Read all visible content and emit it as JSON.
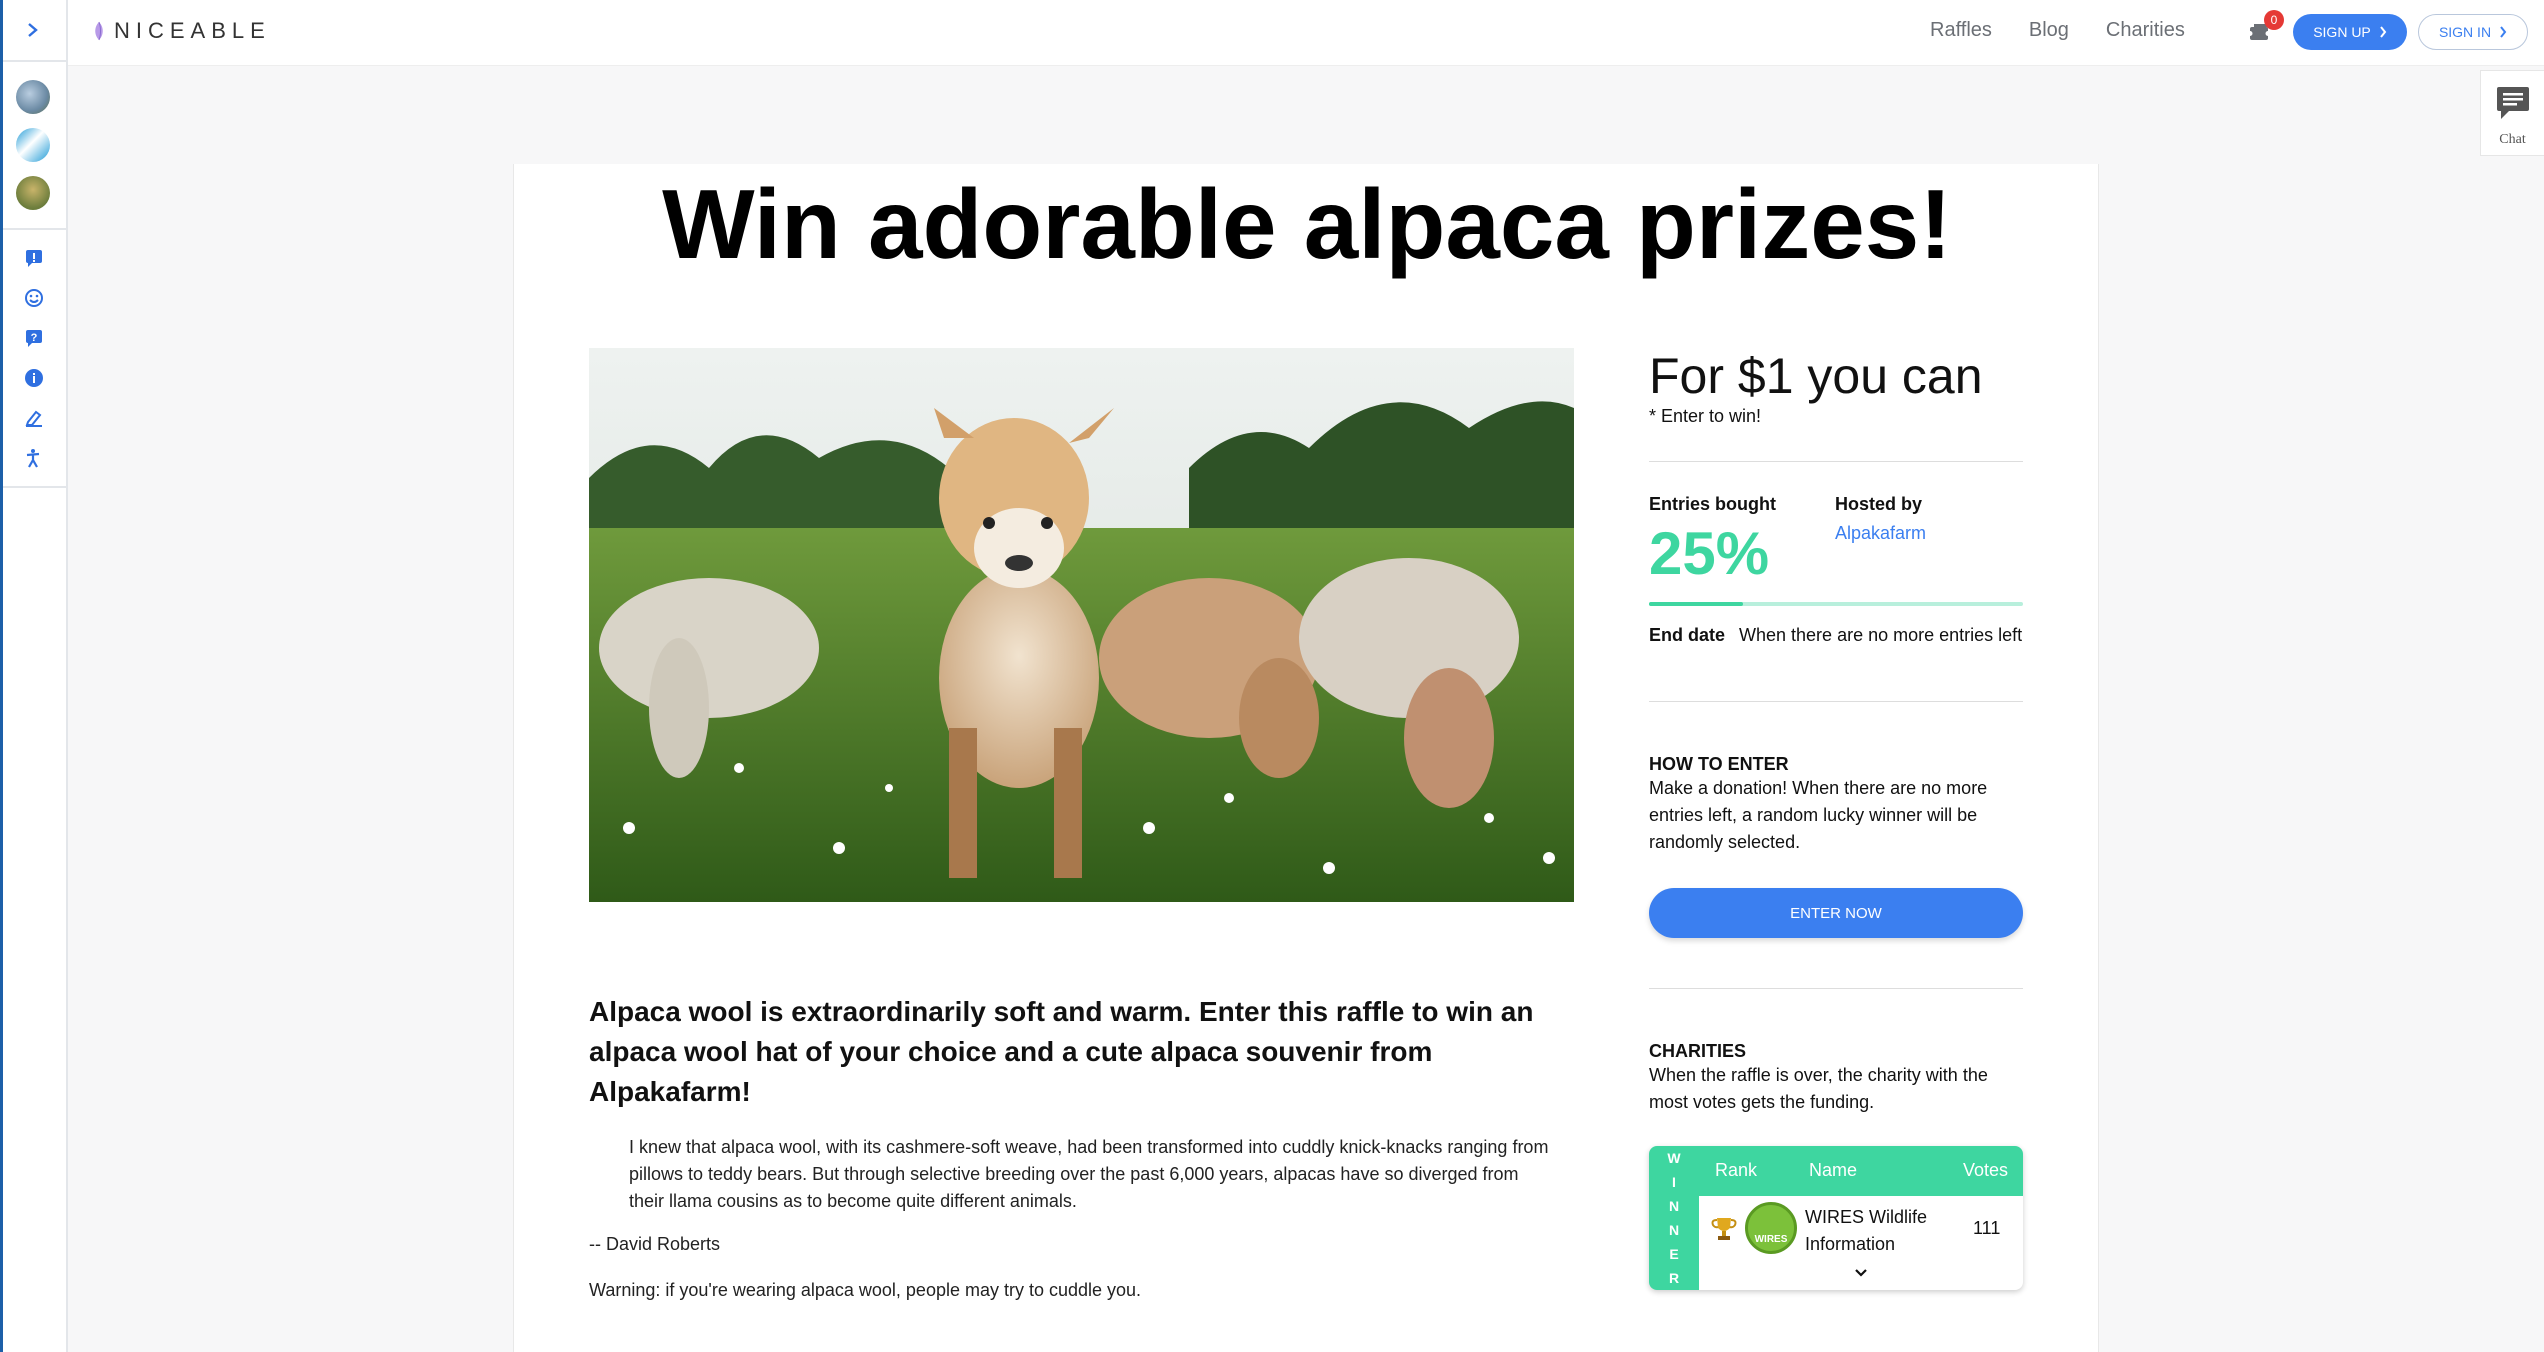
{
  "header": {
    "logo": "NICEABLE",
    "nav": [
      "Raffles",
      "Blog",
      "Charities"
    ],
    "cart_count": "0",
    "signup_label": "SIGN UP",
    "signin_label": "SIGN IN"
  },
  "chat": {
    "label": "Chat"
  },
  "page": {
    "title": "Win adorable alpaca prizes!",
    "lead": "Alpaca wool is extraordinarily soft and warm. Enter this raffle to win an alpaca wool hat of your choice and a cute alpaca souvenir from Alpakafarm!",
    "quote": "I knew that alpaca wool, with its cashmere-soft weave, had been transformed into cuddly knick-knacks ranging from pillows to teddy bears. But through selective breeding over the past 6,000 years, alpacas have so diverged from their llama cousins as to become quite different animals.",
    "author": "-- David Roberts",
    "warning": "Warning: if you're wearing alpaca wool, people may try to cuddle you."
  },
  "side": {
    "for_line": "For $1 you can",
    "enter_line": "* Enter to win!",
    "entries_label": "Entries bought",
    "entries_percent": "25%",
    "entries_fraction": 0.25,
    "hosted_label": "Hosted by",
    "host": "Alpakafarm",
    "end_label": "End date",
    "end_value": "When there are no more entries left",
    "how_title": "HOW TO ENTER",
    "how_text": "Make a donation! When there are no more entries left, a random lucky winner will be randomly selected.",
    "enter_button": "ENTER NOW",
    "charities_title": "CHARITIES",
    "charities_text": "When the raffle is over, the charity with the most votes gets the funding.",
    "table": {
      "winner_letters": [
        "W",
        "I",
        "N",
        "N",
        "E",
        "R"
      ],
      "col_rank": "Rank",
      "col_name": "Name",
      "col_votes": "Votes",
      "row_name": "WIRES Wildlife Information",
      "row_votes": "111",
      "logo_text": "WIRES"
    }
  },
  "colors": {
    "accent": "#3b7ff0",
    "green": "#3ed6a0",
    "badge": "#e53935"
  }
}
